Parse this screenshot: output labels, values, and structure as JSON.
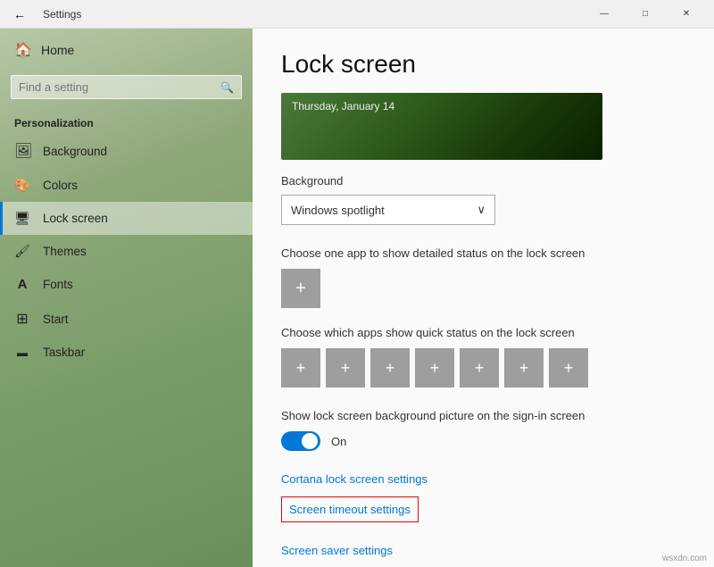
{
  "titleBar": {
    "title": "Settings",
    "backArrow": "←",
    "minimizeLabel": "—",
    "maximizeLabel": "□",
    "closeLabel": "✕"
  },
  "sidebar": {
    "homeLabel": "Home",
    "searchPlaceholder": "Find a setting",
    "sectionTitle": "Personalization",
    "items": [
      {
        "id": "background",
        "label": "Background",
        "icon": "🖼"
      },
      {
        "id": "colors",
        "label": "Colors",
        "icon": "🎨"
      },
      {
        "id": "lock-screen",
        "label": "Lock screen",
        "icon": "🖥"
      },
      {
        "id": "themes",
        "label": "Themes",
        "icon": "🖌"
      },
      {
        "id": "fonts",
        "label": "Fonts",
        "icon": "A"
      },
      {
        "id": "start",
        "label": "Start",
        "icon": "⊞"
      },
      {
        "id": "taskbar",
        "label": "Taskbar",
        "icon": "▬"
      }
    ]
  },
  "content": {
    "pageTitle": "Lock screen",
    "previewDate": "Thursday, January 14",
    "backgroundLabel": "Background",
    "dropdownValue": "Windows spotlight",
    "dropdownChevron": "∨",
    "detailStatusLabel": "Choose one app to show detailed status on the lock screen",
    "addBtnLargeLabel": "+",
    "quickAppsLabel": "Choose which apps show quick status on the lock screen",
    "quickBtns": [
      "+",
      "+",
      "+",
      "+",
      "+",
      "+",
      "+"
    ],
    "signInLabel": "Show lock screen background picture on the sign-in screen",
    "toggleState": "On",
    "links": {
      "cortana": "Cortana lock screen settings",
      "timeout": "Screen timeout settings",
      "screensaver": "Screen saver settings"
    }
  },
  "watermark": "wsxdn.com"
}
